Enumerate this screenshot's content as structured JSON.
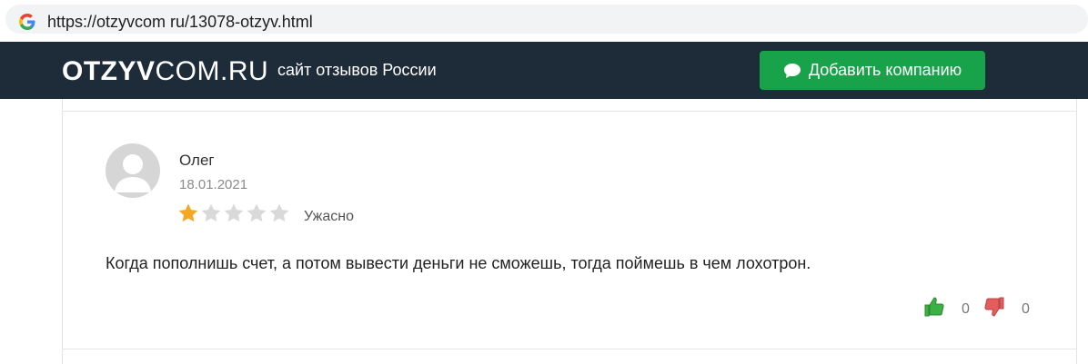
{
  "browser": {
    "url": "https://otzyvcom ru/13078-otzyv.html",
    "favicon": "google-g-icon"
  },
  "header": {
    "logo_bold": "OTZYV",
    "logo_thin": "COM.RU",
    "tagline": "сайт отзывов России",
    "add_button_label": "Добавить компанию",
    "add_button_icon": "chat-bubble-icon",
    "colors": {
      "header_bg": "#1e2b39",
      "button_bg": "#18a24a"
    }
  },
  "review": {
    "author": "Олег",
    "date": "18.01.2021",
    "rating": 1,
    "rating_max": 5,
    "rating_label": "Ужасно",
    "text": "Когда пополнишь счет, а потом вывести деньги не сможешь, тогда поймешь в чем лохотрон.",
    "likes": "0",
    "dislikes": "0",
    "colors": {
      "star_filled": "#f5a623",
      "star_empty": "#d9d9d9",
      "like": "#3cb043",
      "dislike": "#e35d5d"
    }
  }
}
